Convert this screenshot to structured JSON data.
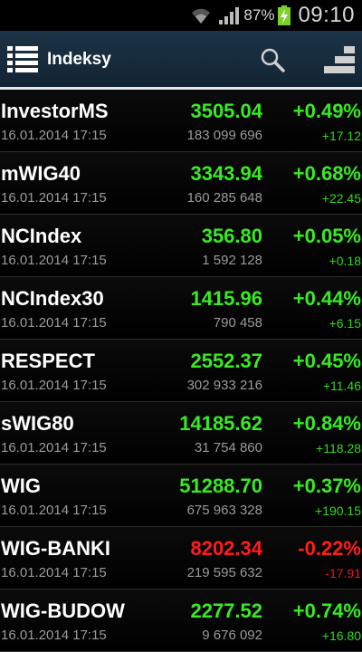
{
  "status_bar": {
    "battery_percent": "87%",
    "time": "09:10",
    "icons": [
      "wifi-icon",
      "signal-icon",
      "battery-charging-icon"
    ]
  },
  "action_bar": {
    "title": "Indeksy",
    "icons": [
      "list-menu-icon",
      "search-icon",
      "chart-icon"
    ]
  },
  "colors": {
    "up": "#38ea24",
    "down": "#ff1c1c",
    "header": "#1c3447"
  },
  "indices": [
    {
      "name": "InvestorMS",
      "date": "16.01.2014 17:15",
      "price": "3505.04",
      "volume": "183 099 696",
      "change_pct": "+0.49%",
      "change": "+17.12",
      "trend": "up"
    },
    {
      "name": "mWIG40",
      "date": "16.01.2014 17:15",
      "price": "3343.94",
      "volume": "160 285 648",
      "change_pct": "+0.68%",
      "change": "+22.45",
      "trend": "up"
    },
    {
      "name": "NCIndex",
      "date": "16.01.2014 17:15",
      "price": "356.80",
      "volume": "1 592 128",
      "change_pct": "+0.05%",
      "change": "+0.18",
      "trend": "up"
    },
    {
      "name": "NCIndex30",
      "date": "16.01.2014 17:15",
      "price": "1415.96",
      "volume": "790 458",
      "change_pct": "+0.44%",
      "change": "+6.15",
      "trend": "up"
    },
    {
      "name": "RESPECT",
      "date": "16.01.2014 17:15",
      "price": "2552.37",
      "volume": "302 933 216",
      "change_pct": "+0.45%",
      "change": "+11.46",
      "trend": "up"
    },
    {
      "name": "sWIG80",
      "date": "16.01.2014 17:15",
      "price": "14185.62",
      "volume": "31 754 860",
      "change_pct": "+0.84%",
      "change": "+118.28",
      "trend": "up"
    },
    {
      "name": "WIG",
      "date": "16.01.2014 17:15",
      "price": "51288.70",
      "volume": "675 963 328",
      "change_pct": "+0.37%",
      "change": "+190.15",
      "trend": "up"
    },
    {
      "name": "WIG-BANKI",
      "date": "16.01.2014 17:15",
      "price": "8202.34",
      "volume": "219 595 632",
      "change_pct": "-0.22%",
      "change": "-17.91",
      "trend": "down"
    },
    {
      "name": "WIG-BUDOW",
      "date": "16.01.2014 17:15",
      "price": "2277.52",
      "volume": "9 676 092",
      "change_pct": "+0.74%",
      "change": "+16.80",
      "trend": "up"
    }
  ]
}
